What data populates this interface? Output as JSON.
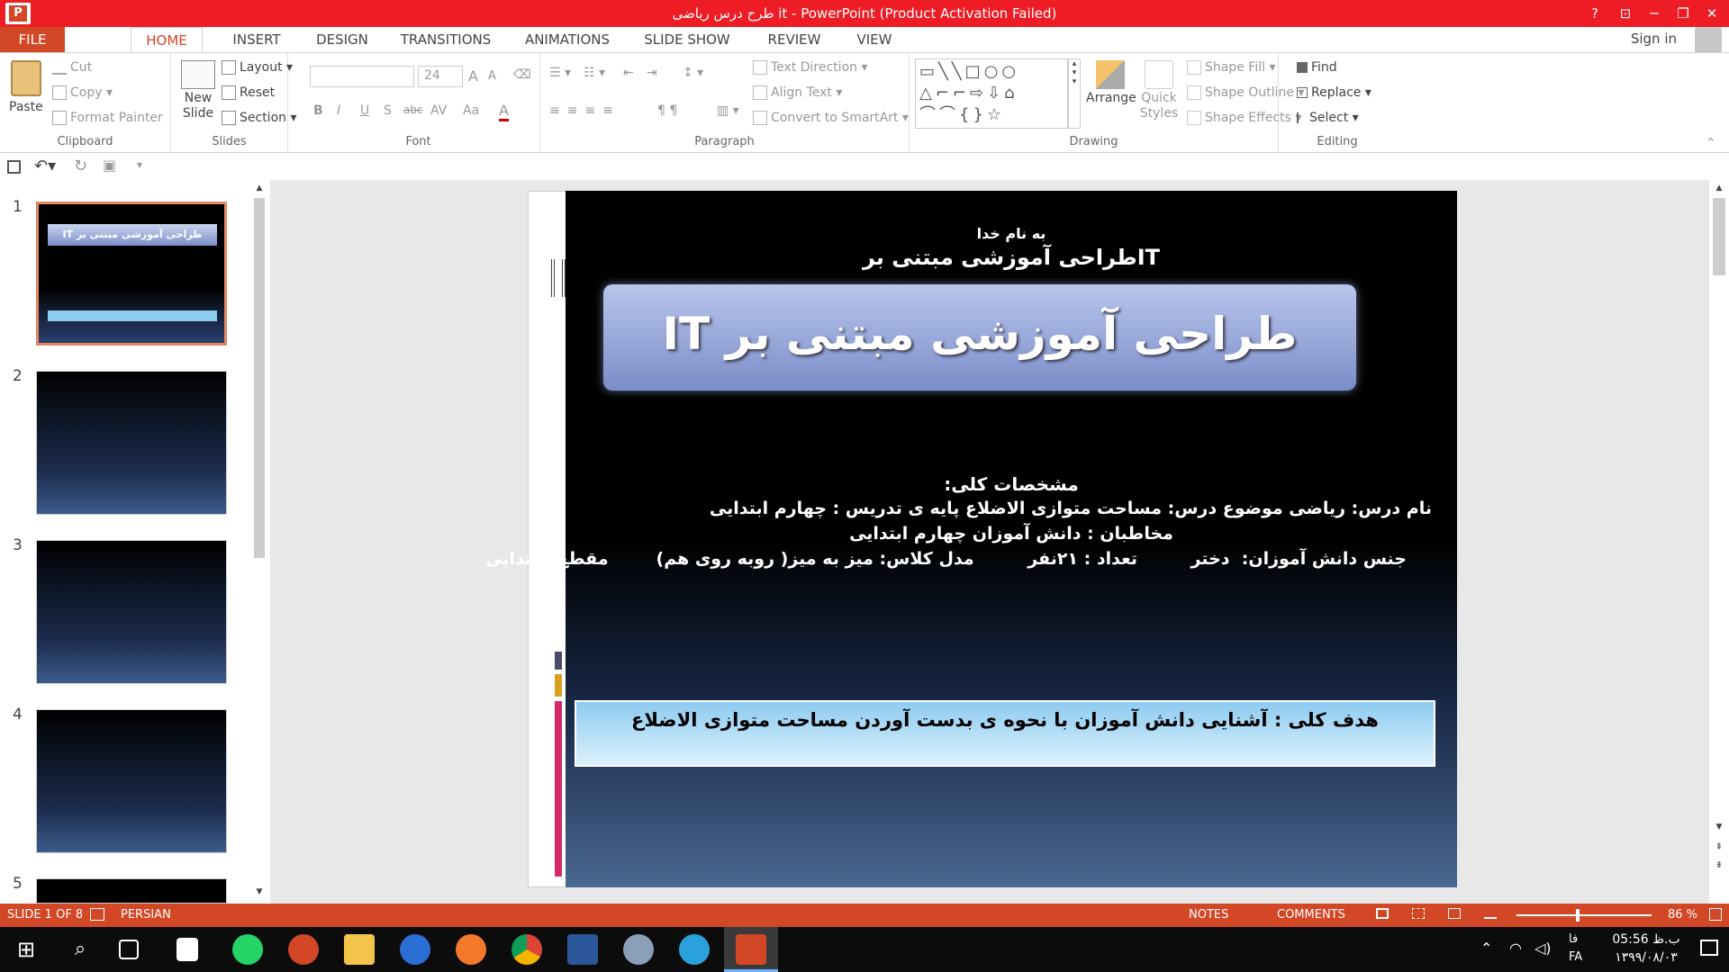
{
  "window": {
    "title": "طرح درس ریاضی it  -  PowerPoint (Product Activation Failed)",
    "help": "?",
    "ribbon_display": "⊡",
    "minimize": "─",
    "restore": "❐",
    "close": "✕"
  },
  "tabs": [
    "FILE",
    "HOME",
    "INSERT",
    "DESIGN",
    "TRANSITIONS",
    "ANIMATIONS",
    "SLIDE SHOW",
    "REVIEW",
    "VIEW"
  ],
  "signin": "Sign in",
  "ribbon": {
    "clipboard": {
      "label": "Clipboard",
      "paste": "Paste",
      "cut": "Cut",
      "copy": "Copy",
      "format_painter": "Format Painter"
    },
    "slides": {
      "label": "Slides",
      "new_slide": "New Slide",
      "layout": "Layout",
      "reset": "Reset",
      "section": "Section"
    },
    "font": {
      "label": "Font",
      "size": "24",
      "bold": "B",
      "italic": "I",
      "underline": "U",
      "shadow": "S",
      "strike": "abc",
      "spacing": "AV",
      "case": "Aa",
      "color": "A",
      "grow": "A",
      "shrink": "A"
    },
    "paragraph": {
      "label": "Paragraph",
      "text_direction": "Text Direction",
      "align_text": "Align Text",
      "convert_smartart": "Convert to SmartArt"
    },
    "drawing": {
      "label": "Drawing",
      "arrange": "Arrange",
      "quick_styles": "Quick Styles",
      "shape_fill": "Shape Fill",
      "shape_outline": "Shape Outline",
      "shape_effects": "Shape Effects"
    },
    "editing": {
      "label": "Editing",
      "find": "Find",
      "replace": "Replace",
      "select": "Select"
    }
  },
  "thumbnails": [
    {
      "num": "1",
      "title": "طراحی آموزشی مبتنی بر IT"
    },
    {
      "num": "2",
      "title": ""
    },
    {
      "num": "3",
      "title": ""
    },
    {
      "num": "4",
      "title": ""
    },
    {
      "num": "5",
      "title": ""
    }
  ],
  "slide": {
    "bismillah": "به نام خدا",
    "subtitle": "ITطراحی آموزشی مبتنی بر",
    "banner": "طراحی آموزشی مبتنی بر IT",
    "specs_heading": "مشخصات کلی:",
    "line1": "نام درس:  ریاضی   موضوع درس: مساحت متوازی الاضلاع    پایه ی تدریس : چهارم  ابتدایی",
    "line2": "مخاطبان : دانش آموزان چهارم ابتدایی",
    "line3": "جنس دانش آموزان:  دختر         تعداد : ۲۱نفر         مدل کلاس: میز به میز( روبه روی هم)        مقطع: ابتدایی",
    "goal": "هدف کلی :   آشنایی دانش آموزان با نحوه ی بدست آوردن مساحت متوازی الاضلاع"
  },
  "status": {
    "slide": "SLIDE 1 OF 8",
    "language": "PERSIAN",
    "notes": "NOTES",
    "comments": "COMMENTS",
    "zoom": "86 %"
  },
  "tray": {
    "time": "05:56 ب.ظ",
    "date": "۱۳۹۹/۰۸/۰۳",
    "lang": "FA",
    "lang2": "فا"
  },
  "colors": {
    "accent": "#d24726",
    "titlebar": "#ee1c24"
  }
}
